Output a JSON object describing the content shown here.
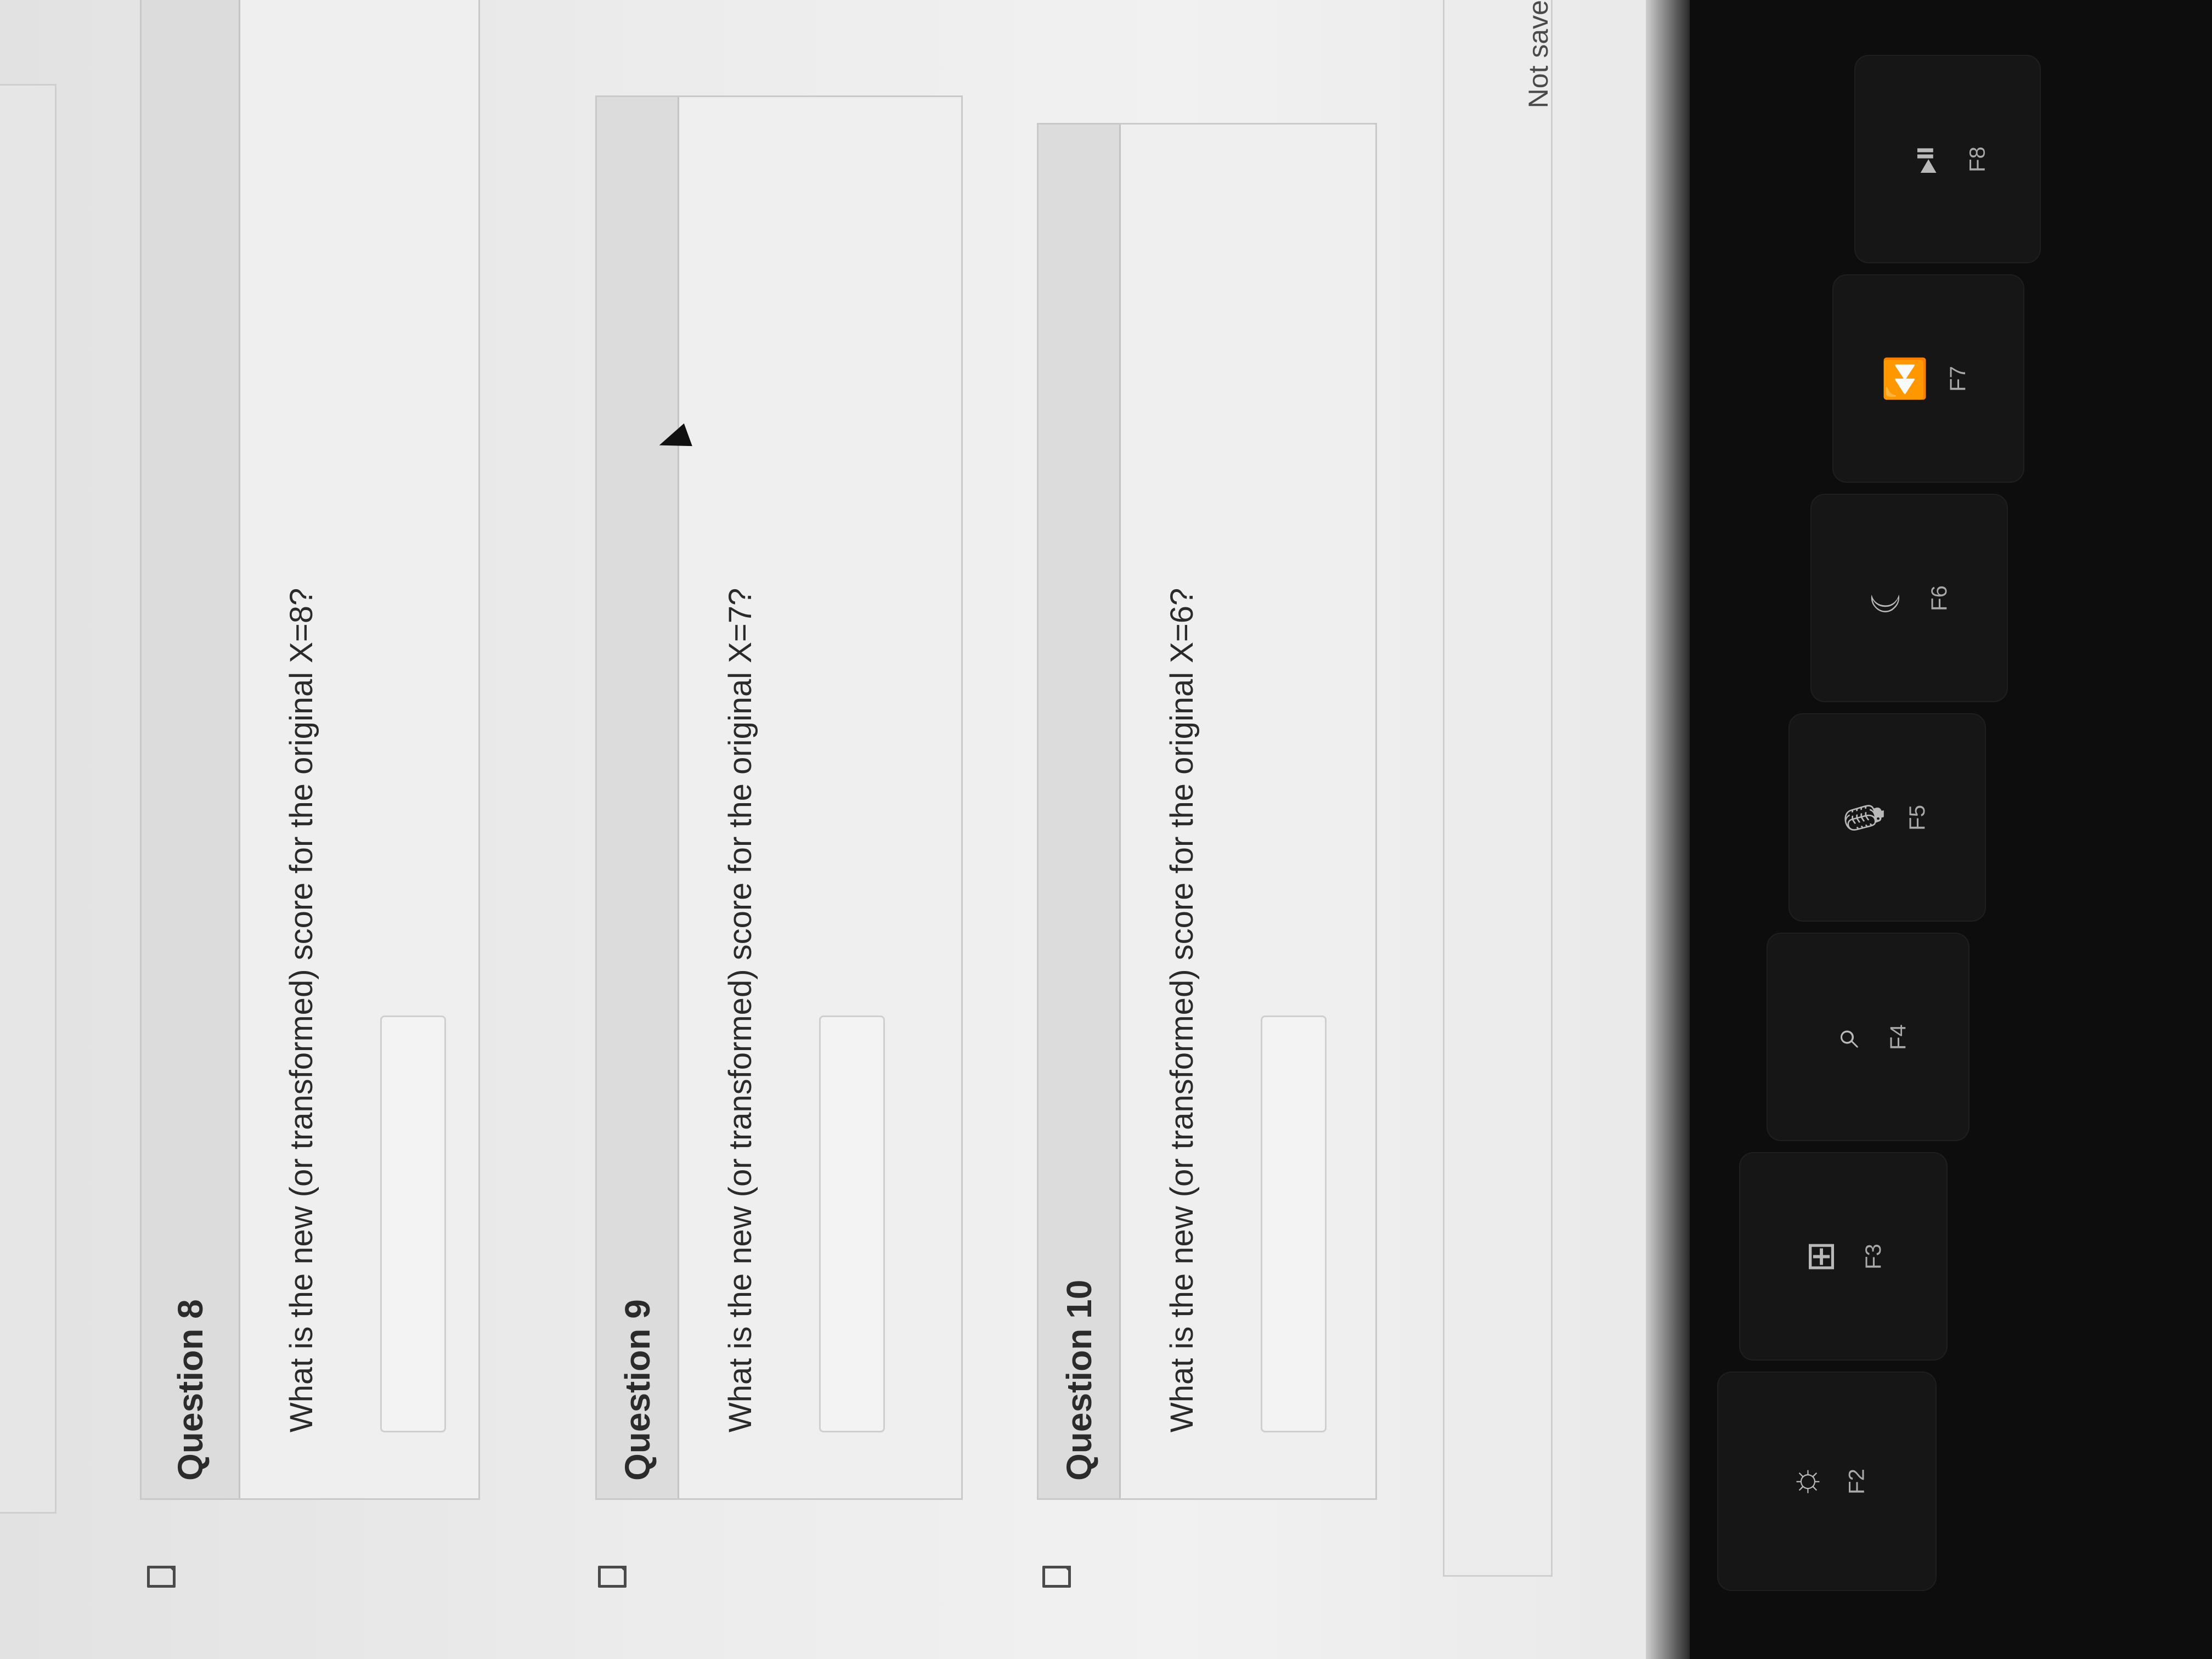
{
  "questions": [
    {
      "title": "Question 8",
      "prompt": "What is the new (or transformed) score for the original X=8?",
      "answer_value": ""
    },
    {
      "title": "Question 9",
      "prompt": "What is the new (or transformed) score for the original X=7?",
      "answer_value": ""
    },
    {
      "title": "Question 10",
      "prompt": "What is the new (or transformed) score for the original X=6?",
      "answer_value": ""
    }
  ],
  "footer": {
    "save_status": "Not save"
  },
  "keyboard": {
    "keys": [
      {
        "label": "F2",
        "icon": "☼"
      },
      {
        "label": "F3",
        "icon": "⊞"
      },
      {
        "label": "F4",
        "icon": "⌕"
      },
      {
        "label": "F5",
        "icon": "🎙"
      },
      {
        "label": "F6",
        "icon": "☾"
      },
      {
        "label": "F7",
        "icon": "⏪"
      },
      {
        "label": "F8",
        "icon": "⏯"
      }
    ]
  }
}
